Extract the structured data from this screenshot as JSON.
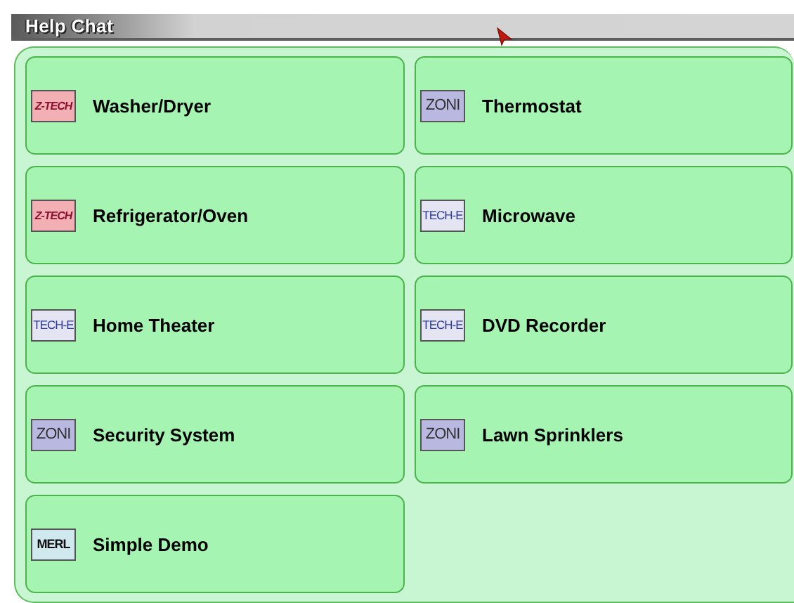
{
  "window": {
    "title": "Help Chat"
  },
  "devices": [
    {
      "label": "Washer/Dryer",
      "logo": {
        "text": "Z-TECH",
        "kind": "ztech"
      }
    },
    {
      "label": "Thermostat",
      "logo": {
        "text": "ZONI",
        "kind": "zoni"
      }
    },
    {
      "label": "Refrigerator/Oven",
      "logo": {
        "text": "Z-TECH",
        "kind": "ztech"
      }
    },
    {
      "label": "Microwave",
      "logo": {
        "text": "TECH-E",
        "kind": "teche"
      }
    },
    {
      "label": "Home Theater",
      "logo": {
        "text": "TECH-E",
        "kind": "teche"
      }
    },
    {
      "label": "DVD Recorder",
      "logo": {
        "text": "TECH-E",
        "kind": "teche"
      }
    },
    {
      "label": "Security System",
      "logo": {
        "text": "ZONI",
        "kind": "zoni"
      }
    },
    {
      "label": "Lawn Sprinklers",
      "logo": {
        "text": "ZONI",
        "kind": "zoni"
      }
    },
    {
      "label": "Simple Demo",
      "logo": {
        "text": "MERL",
        "kind": "merl"
      }
    }
  ]
}
